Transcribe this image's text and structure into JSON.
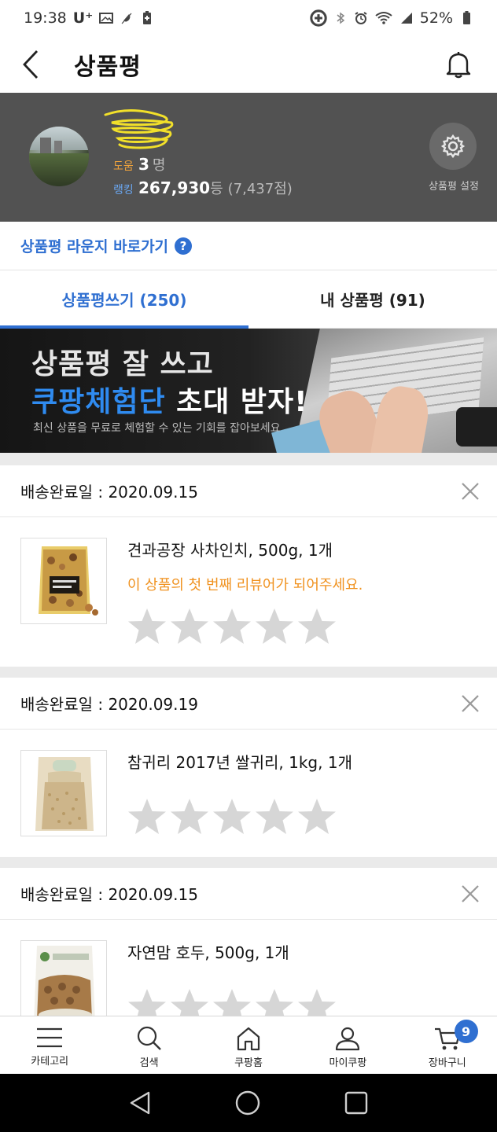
{
  "status_bar": {
    "time": "19:38",
    "carrier": "U⁺",
    "battery": "52%"
  },
  "header": {
    "title": "상품평"
  },
  "profile": {
    "help_label": "도움",
    "help_count": "3",
    "help_unit": "명",
    "rank_label": "랭킹",
    "rank_value": "267,930",
    "rank_unit": "등",
    "rank_points": "(7,437점)",
    "settings_label": "상품평 설정"
  },
  "lounge": {
    "label": "상품평 라운지 바로가기",
    "help_icon": "?"
  },
  "tabs": [
    {
      "label": "상품평쓰기 (250)",
      "active": true
    },
    {
      "label": "내 상품평 (91)",
      "active": false
    }
  ],
  "banner": {
    "line1": "상품평 잘 쓰고",
    "line2_highlight": "쿠팡체험단",
    "line2_rest": " 초대 받자!",
    "line3": "최신 상품을 무료로 체험할 수 있는 기회를 잡아보세요"
  },
  "orders": [
    {
      "date_label": "배송완료일 : 2020.09.15",
      "product": "견과공장 사차인치, 500g, 1개",
      "first_review_message": "이 상품의 첫 번째 리뷰어가 되어주세요.",
      "rating": 0
    },
    {
      "date_label": "배송완료일 : 2020.09.19",
      "product": "참귀리 2017년 쌀귀리, 1kg, 1개",
      "first_review_message": "",
      "rating": 0
    },
    {
      "date_label": "배송완료일 : 2020.09.15",
      "product": "자연맘 호두, 500g, 1개",
      "first_review_message": "",
      "rating": 0
    }
  ],
  "bottom_nav": [
    {
      "label": "카테고리",
      "icon": "menu-icon"
    },
    {
      "label": "검색",
      "icon": "search-icon"
    },
    {
      "label": "쿠팡홈",
      "icon": "home-icon"
    },
    {
      "label": "마이쿠팡",
      "icon": "user-icon"
    },
    {
      "label": "장바구니",
      "icon": "cart-icon"
    }
  ],
  "cart_badge": "9",
  "colors": {
    "accent_blue": "#2f6fd1",
    "help_orange": "#f0a33c",
    "rank_blue": "#6aa6f0",
    "first_review_orange": "#f0921f",
    "profile_bg": "#525252",
    "star_gray": "#d6d6d6"
  }
}
